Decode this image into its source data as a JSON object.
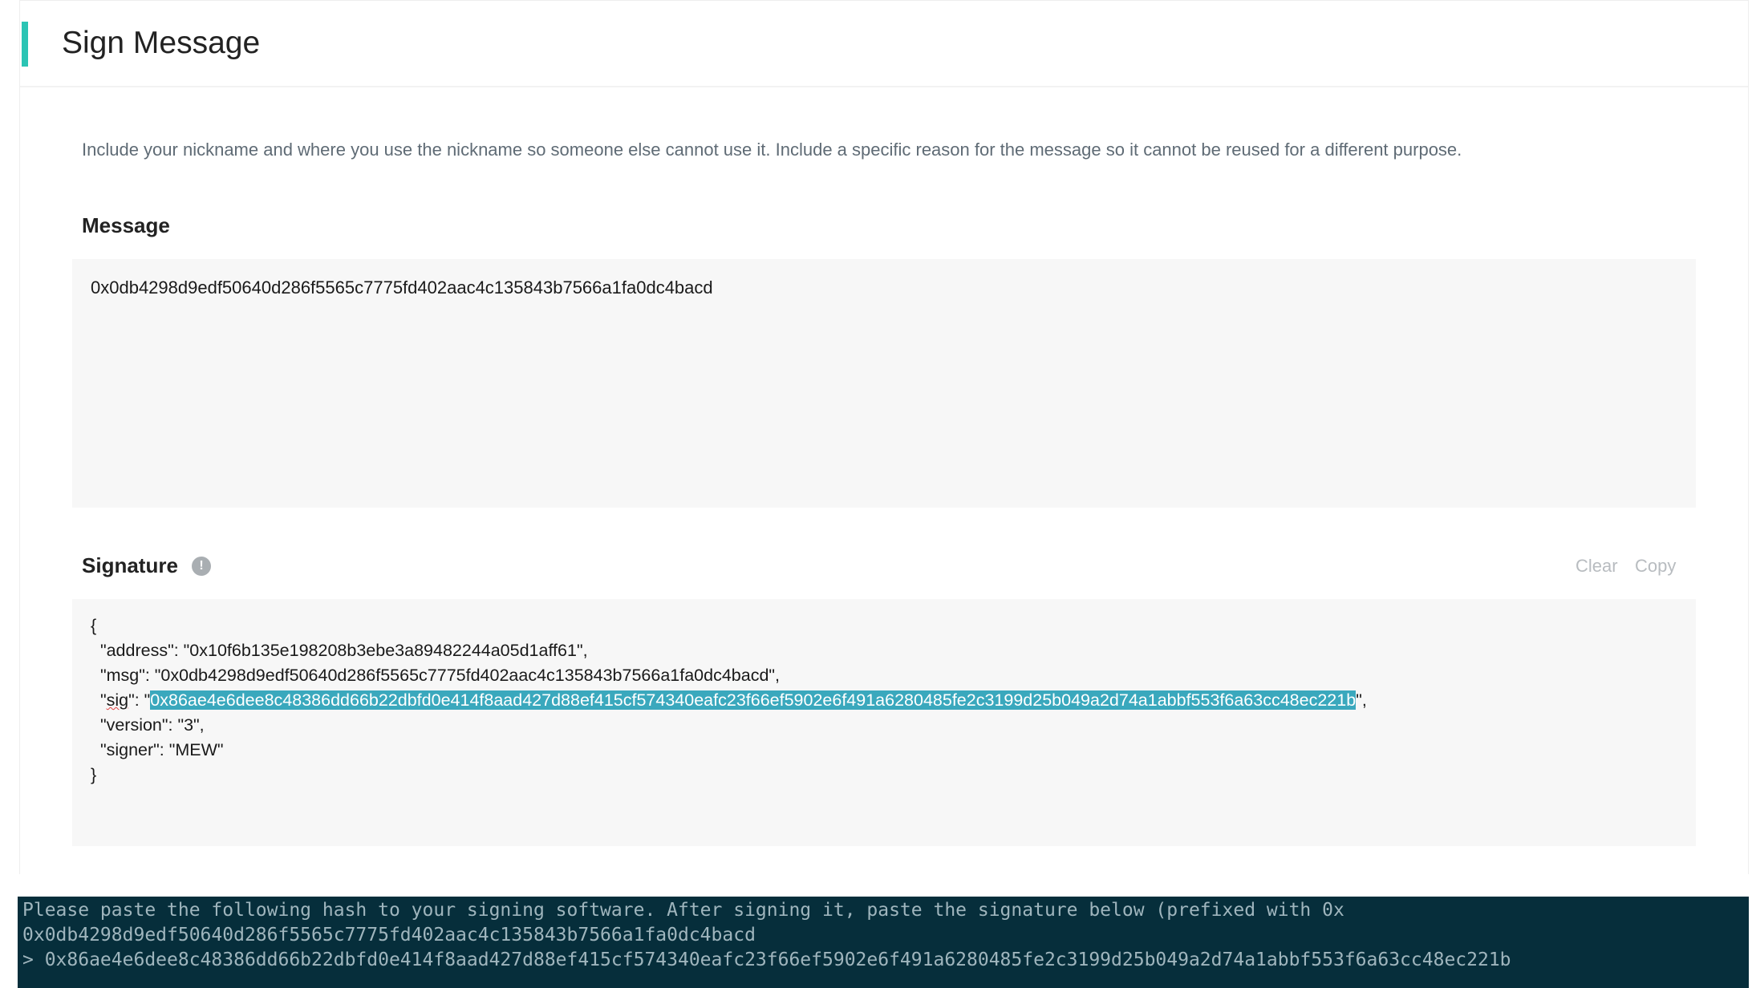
{
  "page": {
    "title": "Sign Message",
    "description": "Include your nickname and where you use the nickname so someone else cannot use it. Include a specific reason for the message so it cannot be reused for a different purpose."
  },
  "message": {
    "label": "Message",
    "value": "0x0db4298d9edf50640d286f5565c7775fd402aac4c135843b7566a1fa0dc4bacd"
  },
  "signature": {
    "label": "Signature",
    "info_icon": "info-icon",
    "clear_label": "Clear",
    "copy_label": "Copy",
    "json": {
      "open": "{",
      "address_prefix": "  \"address\": ",
      "address_value": "\"0x10f6b135e198208b3ebe3a89482244a05d1aff61\",",
      "msg_prefix": "  \"msg\": ",
      "msg_value": "\"0x0db4298d9edf50640d286f5565c7775fd402aac4c135843b7566a1fa0dc4bacd\",",
      "sig_key_quote": "  \"",
      "sig_key": "sig",
      "sig_mid": "\": \"",
      "sig_value": "0x86ae4e6dee8c48386dd66b22dbfd0e414f8aad427d88ef415cf574340eafc23f66ef5902e6f491a6280485fe2c3199d25b049a2d74a1abbf553f6a63cc48ec221b",
      "sig_end": "\",",
      "version_line": "  \"version\": \"3\",",
      "signer_line": "  \"signer\": \"MEW\"",
      "close": "}"
    }
  },
  "terminal": {
    "line1": "Please paste the following hash to your signing software. After signing it, paste the signature below (prefixed with 0x",
    "line2": "0x0db4298d9edf50640d286f5565c7775fd402aac4c135843b7566a1fa0dc4bacd",
    "line3": "> 0x86ae4e6dee8c48386dd66b22dbfd0e414f8aad427d88ef415cf574340eafc23f66ef5902e6f491a6280485fe2c3199d25b049a2d74a1abbf553f6a63cc48ec221b"
  },
  "colors": {
    "accent": "#2bc4b4",
    "selection": "#3aa8bd",
    "terminal_bg": "#062e3b"
  }
}
